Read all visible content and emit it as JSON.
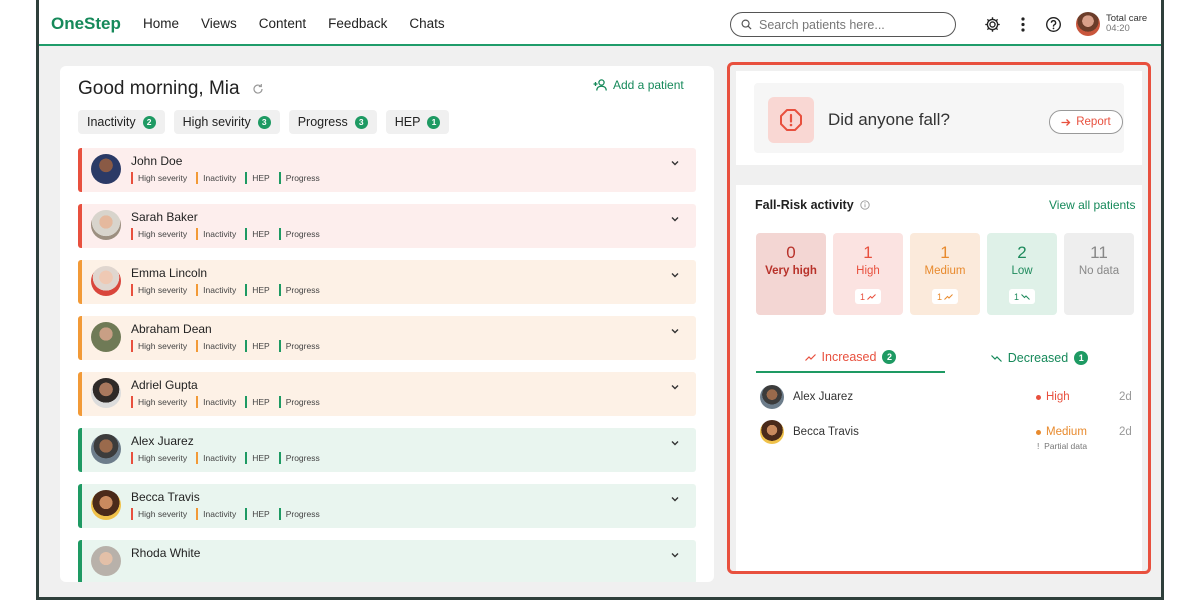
{
  "app": {
    "name": "OneStep"
  },
  "nav": [
    "Home",
    "Views",
    "Content",
    "Feedback",
    "Chats"
  ],
  "search": {
    "placeholder": "Search patients here...",
    "value": ""
  },
  "user": {
    "line1": "Total care",
    "line2": "04:20"
  },
  "greeting": "Good morning, Mia",
  "add_patient": "Add a patient",
  "filters": [
    {
      "label": "Inactivity",
      "count": "2"
    },
    {
      "label": "High sevirity",
      "count": "3"
    },
    {
      "label": "Progress",
      "count": "3"
    },
    {
      "label": "HEP",
      "count": "1"
    }
  ],
  "patient_tags": [
    "High severity",
    "Inactivity",
    "HEP",
    "Progress"
  ],
  "patients": [
    {
      "name": "John Doe",
      "status": "red"
    },
    {
      "name": "Sarah Baker",
      "status": "red"
    },
    {
      "name": "Emma Lincoln",
      "status": "orange"
    },
    {
      "name": "Abraham Dean",
      "status": "orange"
    },
    {
      "name": "Adriel Gupta",
      "status": "orange"
    },
    {
      "name": "Alex Juarez",
      "status": "green"
    },
    {
      "name": "Becca Travis",
      "status": "green"
    },
    {
      "name": "Rhoda White",
      "status": "green"
    }
  ],
  "fall": {
    "question": "Did anyone fall?",
    "report_label": "Report"
  },
  "risk": {
    "title": "Fall-Risk activity",
    "view_all": "View all patients",
    "tiles": [
      {
        "count": "0",
        "label": "Very high",
        "delta": ""
      },
      {
        "count": "1",
        "label": "High",
        "delta": "1"
      },
      {
        "count": "1",
        "label": "Medium",
        "delta": "1"
      },
      {
        "count": "2",
        "label": "Low",
        "delta": "1"
      },
      {
        "count": "11",
        "label": "No data",
        "delta": ""
      }
    ],
    "tabs": [
      {
        "label": "Increased",
        "count": "2"
      },
      {
        "label": "Decreased",
        "count": "1"
      }
    ],
    "list": [
      {
        "name": "Alex Juarez",
        "level": "High",
        "sub": "",
        "time": "2d"
      },
      {
        "name": "Becca Travis",
        "level": "Medium",
        "sub": "Partial data",
        "time": "2d"
      }
    ]
  },
  "colors": {
    "brand": "#16895a",
    "red": "#e8503e",
    "orange": "#f29a37",
    "green": "#1e9a63"
  }
}
